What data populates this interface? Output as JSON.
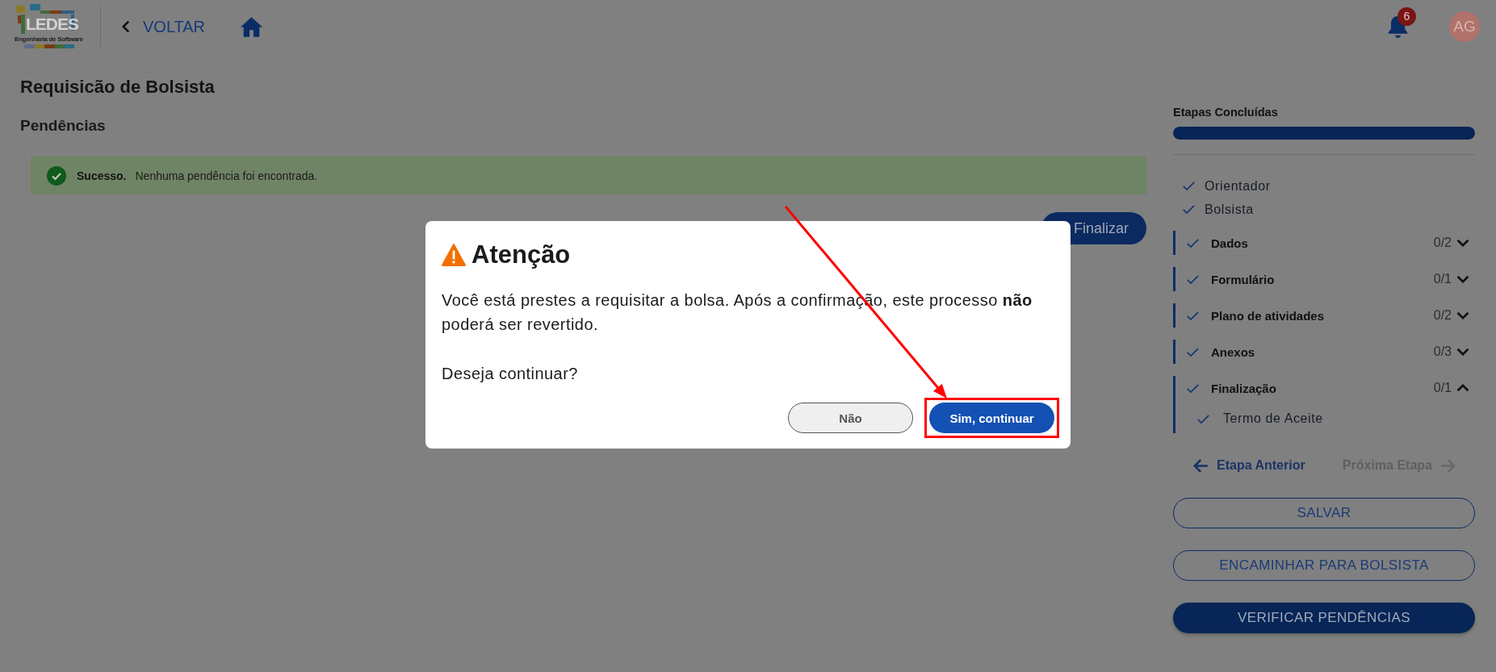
{
  "header": {
    "logo": {
      "title": "LEDES",
      "subtitle": "Engenharia de Software"
    },
    "back_link": {
      "label": "VOLTAR"
    },
    "notifications": {
      "count": "6"
    },
    "avatar": {
      "initials": "AG"
    }
  },
  "page": {
    "title": "Requisicão de Bolsista",
    "section_title": "Pendências",
    "alert": {
      "kind": "success",
      "title": "Sucesso.",
      "message": "Nenhuma pendência foi encontrada."
    },
    "primary_button": {
      "label": "Finalizar"
    }
  },
  "sidebar": {
    "title": "Etapas Concluídas",
    "progress": {
      "level": 1
    },
    "steps": [
      {
        "label": "Orientador",
        "checked": true
      },
      {
        "label": "Bolsista",
        "checked": true
      }
    ],
    "sections": [
      {
        "label": "Dados",
        "count": "0/2",
        "checked": true,
        "expanded": false
      },
      {
        "label": "Formulário",
        "count": "0/1",
        "checked": true,
        "expanded": false
      },
      {
        "label": "Plano de atividades",
        "count": "0/2",
        "checked": true,
        "expanded": false
      },
      {
        "label": "Anexos",
        "count": "0/3",
        "checked": true,
        "expanded": false
      },
      {
        "label": "Finalização",
        "count": "0/1",
        "checked": true,
        "expanded": true,
        "children": [
          {
            "label": "Termo de Aceite",
            "checked": true
          }
        ]
      }
    ],
    "nav": {
      "previous": {
        "label": "Etapa Anterior",
        "disabled": false
      },
      "next": {
        "label": "Próxima Etapa",
        "disabled": true
      }
    },
    "buttons": [
      {
        "label": "SALVAR",
        "kind": "outline"
      },
      {
        "label": "ENCAMINHAR PARA BOLSISTA",
        "kind": "outline"
      },
      {
        "label": "VERIFICAR PENDÊNCIAS",
        "kind": "filled"
      }
    ]
  },
  "dialog": {
    "kind": "warning",
    "title": "Atenção",
    "message": "Você está prestes a requisitar a bolsa. Após a confirmação, este processo **não** poderá ser revertido.",
    "question": "Deseja continuar?",
    "buttons": [
      {
        "label": "Não",
        "kind": "secondary",
        "highlighted": false
      },
      {
        "label": "Sim, continuar",
        "kind": "primary",
        "highlighted": true
      }
    ]
  }
}
